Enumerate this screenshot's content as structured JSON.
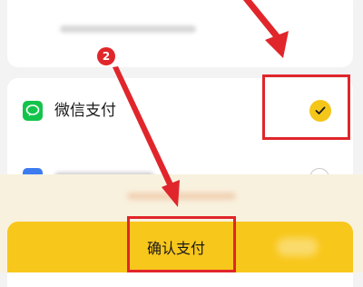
{
  "payment_methods": [
    {
      "label": "微信支付",
      "icon": "wechat-pay-icon",
      "selected": true
    },
    {
      "label": "",
      "icon": "alipay-icon",
      "selected": false
    }
  ],
  "confirm": {
    "label": "确认支付"
  },
  "annotation": {
    "step_number": "2"
  },
  "colors": {
    "accent": "#f8c71c",
    "check": "#f4c61a",
    "wechat_green": "#13c44a",
    "alipay_blue": "#3d7cf0",
    "annotation_red": "#e0262b"
  }
}
